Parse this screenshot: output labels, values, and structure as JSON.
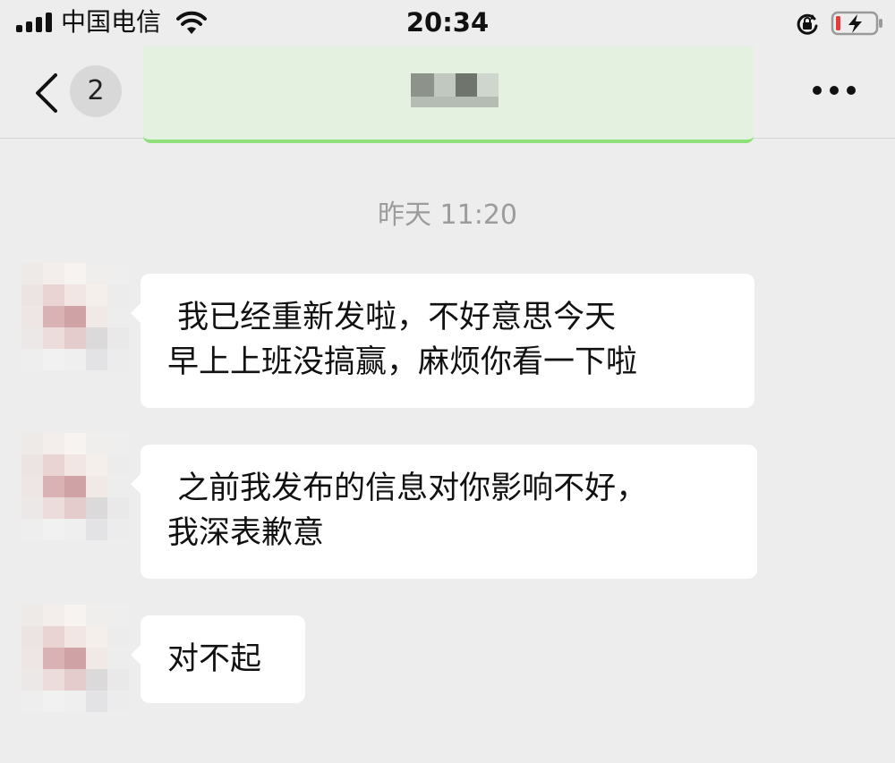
{
  "status_bar": {
    "carrier": "中国电信",
    "time": "20:34",
    "icons": [
      "signal-icon",
      "wifi-icon",
      "orientation-lock-icon",
      "battery-charging-icon"
    ]
  },
  "nav": {
    "unread_count": "2",
    "title": "",
    "icons": [
      "back-icon",
      "more-icon"
    ]
  },
  "chat": {
    "timestamp": "昨天 11:20",
    "messages": [
      {
        "sender": "contact",
        "text": " 我已经重新发啦，不好意思今天\n早上上班没搞赢，麻烦你看一下啦"
      },
      {
        "sender": "contact",
        "text": " 之前我发布的信息对你影响不好，\n我深表歉意"
      },
      {
        "sender": "contact",
        "text": "对不起"
      }
    ]
  },
  "colors": {
    "background": "#ededed",
    "bubble": "#ffffff",
    "nav_highlight": "#e4f1e0",
    "nav_highlight_border": "#8fe07a",
    "timestamp_text": "#9c9c9c"
  }
}
